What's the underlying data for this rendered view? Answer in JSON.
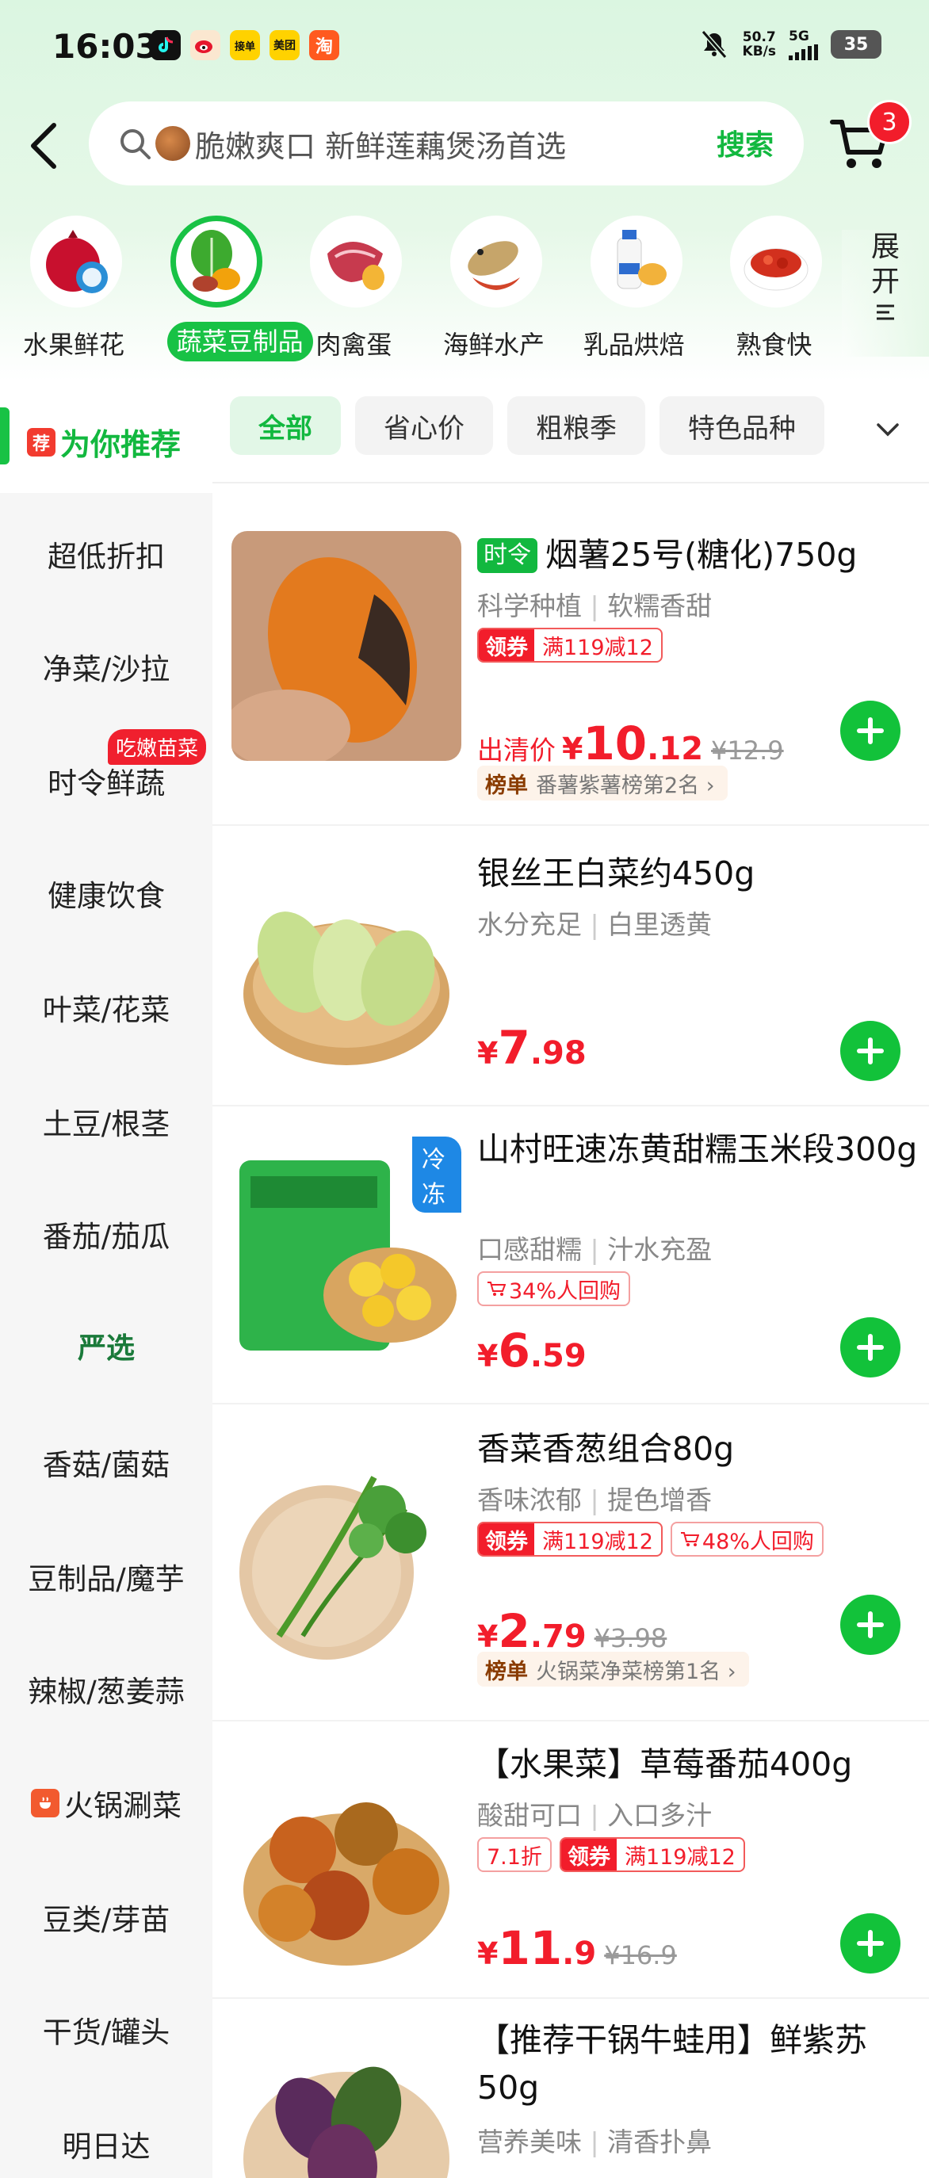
{
  "status_bar": {
    "time": "16:03",
    "app_icons": [
      {
        "name": "douyin-icon",
        "label": "",
        "color": "#111111"
      },
      {
        "name": "weibo-icon",
        "label": "",
        "color": "#f5a623"
      },
      {
        "name": "app3-icon",
        "label": "接单",
        "color": "#ffd200"
      },
      {
        "name": "meituan-icon",
        "label": "美团",
        "color": "#ffd200"
      },
      {
        "name": "taobao-icon",
        "label": "淘",
        "color": "#ff5a1f"
      }
    ],
    "net_speed": "50.7",
    "net_speed_unit": "KB/s",
    "net_type": "5G",
    "battery": "35"
  },
  "header": {
    "search_placeholder": "脆嫩爽口 新鲜莲藕煲汤首选",
    "search_button": "搜索",
    "cart_count": "3"
  },
  "categories": [
    {
      "label": "水果鲜花",
      "icon": "pomegranate-icon",
      "active": false
    },
    {
      "label": "蔬菜豆制品",
      "icon": "vegetables-icon",
      "active": true
    },
    {
      "label": "肉禽蛋",
      "icon": "meat-icon",
      "active": false
    },
    {
      "label": "海鲜水产",
      "icon": "seafood-icon",
      "active": false
    },
    {
      "label": "乳品烘焙",
      "icon": "milk-icon",
      "active": false
    },
    {
      "label": "熟食快",
      "icon": "crayfish-icon",
      "active": false
    }
  ],
  "expand_label": [
    "展",
    "开"
  ],
  "sidebar": {
    "active_tag": "荐",
    "active_label": "为你推荐",
    "badge": "吃嫩苗菜",
    "items": [
      "超低折扣",
      "净菜/沙拉",
      "时令鲜蔬",
      "健康饮食",
      "叶菜/花菜",
      "土豆/根茎",
      "番茄/茄瓜",
      "严选",
      "香菇/菌菇",
      "豆制品/魔芋",
      "辣椒/葱姜蒜",
      "火锅涮菜",
      "豆类/芽苗",
      "干货/罐头",
      "明日达"
    ]
  },
  "filters": [
    "全部",
    "省心价",
    "粗粮季",
    "特色品种"
  ],
  "products": [
    {
      "season_badge": "时令",
      "title": "烟薯25号(糖化)750g",
      "sub1": "科学种植",
      "sub2": "软糯香甜",
      "coupon_label": "领券",
      "coupon_text": "满119减12",
      "price_prefix": "出清价",
      "currency": "¥",
      "price_int": "10",
      "price_dec": ".12",
      "orig_price": "¥12.9",
      "rank_label": "榜单",
      "rank_text": "番薯紫薯榜第2名 ›"
    },
    {
      "title": "银丝王白菜约450g",
      "sub1": "水分充足",
      "sub2": "白里透黄",
      "currency": "¥",
      "price_int": "7",
      "price_dec": ".98"
    },
    {
      "cold_tag": "冷冻",
      "title": "山村旺速冻黄甜糯玉米段300g",
      "sub1": "口感甜糯",
      "sub2": "汁水充盈",
      "repurchase": "34%人回购",
      "currency": "¥",
      "price_int": "6",
      "price_dec": ".59"
    },
    {
      "title": "香菜香葱组合80g",
      "sub1": "香味浓郁",
      "sub2": "提色增香",
      "coupon_label": "领券",
      "coupon_text": "满119减12",
      "repurchase": "48%人回购",
      "currency": "¥",
      "price_int": "2",
      "price_dec": ".79",
      "orig_price": "¥3.98",
      "rank_label": "榜单",
      "rank_text": "火锅菜净菜榜第1名 ›"
    },
    {
      "title": "【水果菜】草莓番茄400g",
      "sub1": "酸甜可口",
      "sub2": "入口多汁",
      "discount": "7.1折",
      "coupon_label": "领券",
      "coupon_text": "满119减12",
      "currency": "¥",
      "price_int": "11",
      "price_dec": ".9",
      "orig_price": "¥16.9"
    },
    {
      "title": "【推荐干锅牛蛙用】鲜紫苏50g",
      "sub1": "营养美味",
      "sub2": "清香扑鼻"
    }
  ]
}
